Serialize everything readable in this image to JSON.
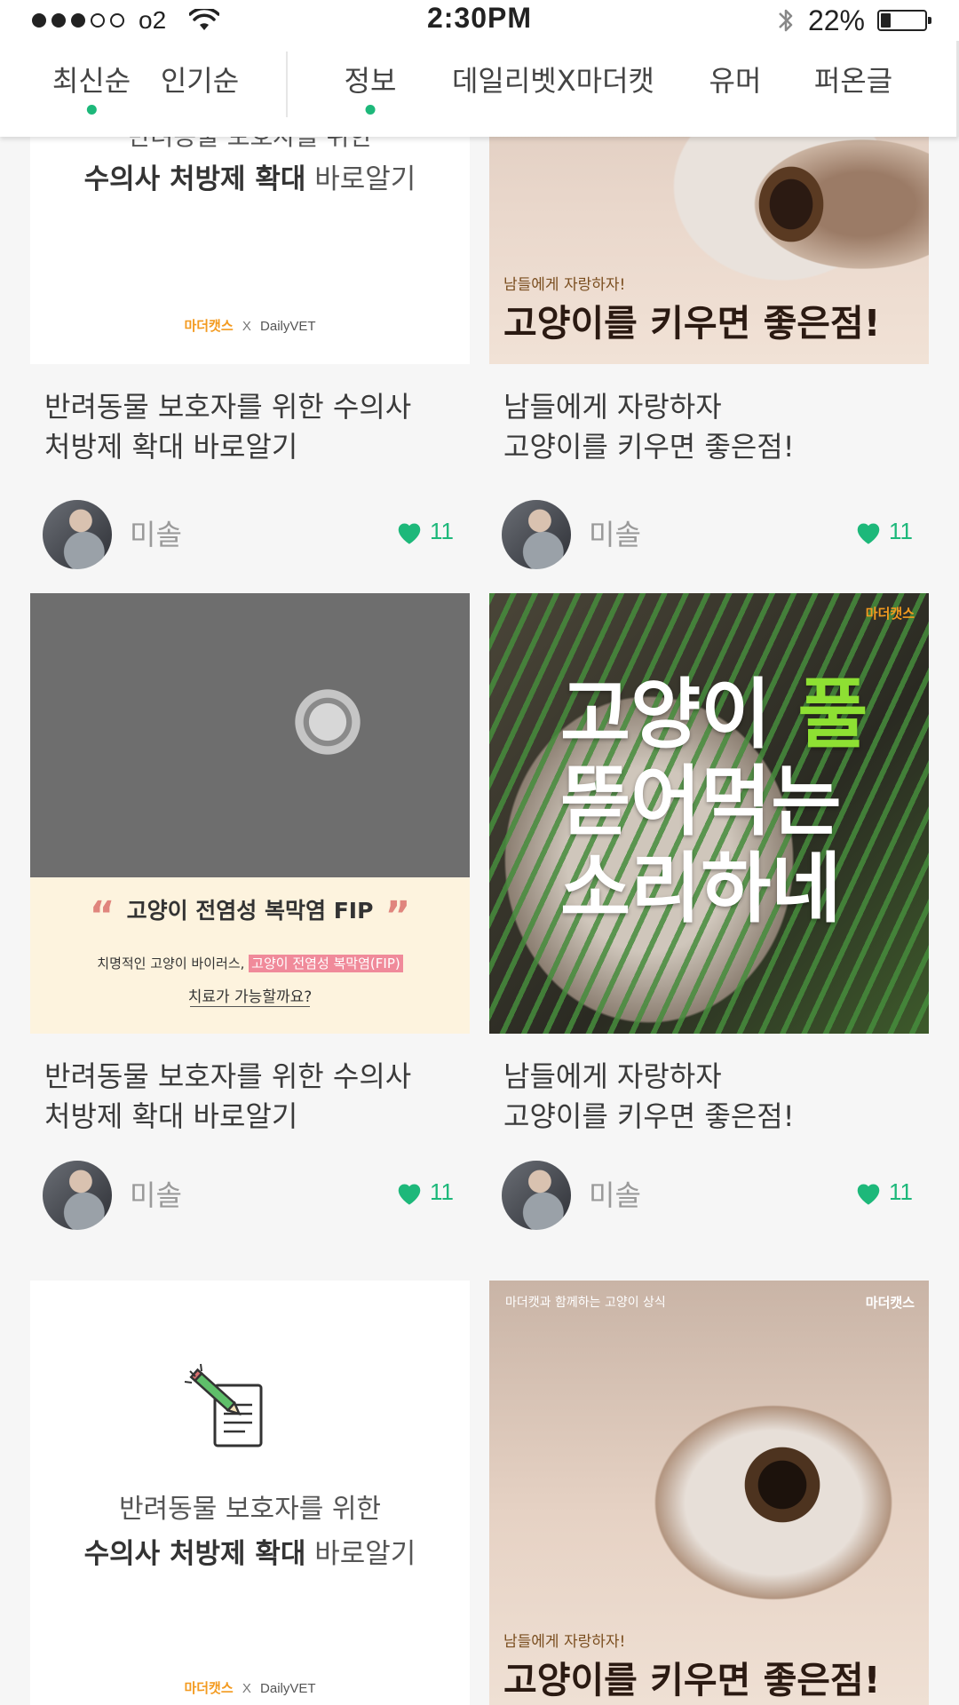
{
  "status_bar": {
    "carrier": "o2",
    "time": "2:30PM",
    "battery_percent": "22%",
    "battery_level": 0.22,
    "signal_dots_filled": 3,
    "signal_dots_total": 5
  },
  "tabs": {
    "sort": [
      {
        "label": "최신순",
        "active": true
      },
      {
        "label": "인기순",
        "active": false
      }
    ],
    "categories": [
      {
        "label": "정보",
        "active": true
      },
      {
        "label": "데일리벳X마더캣",
        "active": false
      },
      {
        "label": "유머",
        "active": false
      },
      {
        "label": "퍼온글",
        "active": false
      }
    ]
  },
  "colors": {
    "accent": "#1db87a",
    "brand_orange": "#f39a1f",
    "highlight_pink": "#f08a9a"
  },
  "cards": [
    {
      "thumb": {
        "top_cut_text": "반려동물 보호자를 위한",
        "line_bold": "수의사 처방제 확대",
        "line_regular": "바로알기",
        "brand_left": "마더캣스",
        "brand_x": "X",
        "brand_right": "DailyVET"
      },
      "title_line1": "반려동물 보호자를 위한 수의사",
      "title_line2": "처방제 확대 바로알기",
      "author": "미솔",
      "likes": "11"
    },
    {
      "thumb": {
        "sub": "남들에게 자랑하자!",
        "headline": "고양이를 키우면 좋은점!"
      },
      "title_line1": "남들에게 자랑하자",
      "title_line2": "고양이를 키우면 좋은점!",
      "author": "미솔",
      "likes": "11"
    },
    {
      "thumb": {
        "quote_open": "“",
        "headline": "고양이 전염성 복막염 FIP",
        "quote_close": "”",
        "sub_prefix": "치명적인 고양이 바이러스,",
        "sub_highlight": "고양이 전염성 복막염(FIP)",
        "question": "치료가 가능할까요?"
      },
      "title_line1": "반려동물 보호자를 위한 수의사",
      "title_line2": "처방제 확대 바로알기",
      "author": "미솔",
      "likes": "11"
    },
    {
      "thumb": {
        "brand": "마더캣스",
        "line1_a": "고양이",
        "line1_b": "풀",
        "line2": "뜯어먹는",
        "line3": "소리하네"
      },
      "title_line1": "남들에게 자랑하자",
      "title_line2": "고양이를 키우면 좋은점!",
      "author": "미솔",
      "likes": "11"
    },
    {
      "thumb": {
        "line1": "반려동물 보호자를 위한",
        "line_bold": "수의사 처방제 확대",
        "line_regular": "바로알기",
        "brand_left": "마더캣스",
        "brand_x": "X",
        "brand_right": "DailyVET"
      }
    },
    {
      "thumb": {
        "top_left": "마더캣과 함께하는 고양이 상식",
        "brand": "마더캣스",
        "sub": "남들에게 자랑하자!",
        "headline": "고양이를 키우면 좋은점!"
      }
    }
  ]
}
